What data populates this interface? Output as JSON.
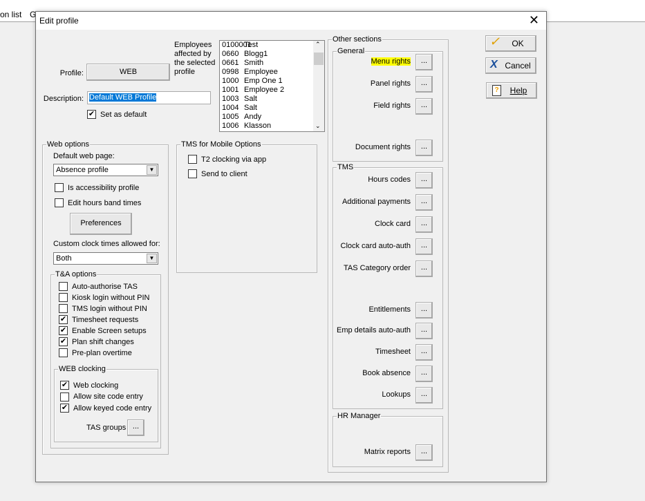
{
  "background": {
    "menu_fragment_1": "on list",
    "menu_fragment_2": "G"
  },
  "dialog": {
    "title": "Edit profile",
    "close_label": "✕"
  },
  "profile": {
    "label": "Profile:",
    "value": "WEB",
    "employees_label": "Employees affected by the selected profile",
    "description_label": "Description:",
    "description_value": "Default WEB Profile",
    "set_default_label": "Set as default",
    "set_default_checked": true
  },
  "employees": [
    [
      "0100001",
      "Test"
    ],
    [
      "0660",
      "Blogg1"
    ],
    [
      "0661",
      "Smith"
    ],
    [
      "0998",
      "Employee"
    ],
    [
      "1000",
      "Emp One 1"
    ],
    [
      "1001",
      "Employee 2"
    ],
    [
      "1003",
      "Salt"
    ],
    [
      "1004",
      "Salt"
    ],
    [
      "1005",
      "Andy"
    ],
    [
      "1006",
      "Klasson"
    ]
  ],
  "web_options": {
    "legend": "Web options",
    "default_page_label": "Default web page:",
    "default_page_value": "Absence profile",
    "accessibility_label": "Is accessibility profile",
    "edit_hours_label": "Edit hours band times",
    "preferences_label": "Preferences",
    "custom_clock_label": "Custom clock times allowed for:",
    "custom_clock_value": "Both"
  },
  "ta_options": {
    "legend": "T&A options",
    "items": [
      {
        "label": "Auto-authorise TAS",
        "checked": false
      },
      {
        "label": "Kiosk login without PIN",
        "checked": false
      },
      {
        "label": "TMS login without PIN",
        "checked": false
      },
      {
        "label": "Timesheet requests",
        "checked": true
      },
      {
        "label": "Enable Screen setups",
        "checked": true
      },
      {
        "label": "Plan shift changes",
        "checked": true
      },
      {
        "label": "Pre-plan overtime",
        "checked": false
      }
    ]
  },
  "web_clocking": {
    "legend": "WEB clocking",
    "items": [
      {
        "label": "Web clocking",
        "checked": true
      },
      {
        "label": "Allow site code entry",
        "checked": false
      },
      {
        "label": "Allow keyed code entry",
        "checked": true
      }
    ],
    "tas_groups_label": "TAS groups"
  },
  "tms_mobile": {
    "legend": "TMS for Mobile Options",
    "items": [
      {
        "label": "T2 clocking via app",
        "checked": false
      },
      {
        "label": "Send to client",
        "checked": false
      }
    ]
  },
  "other_sections": {
    "legend": "Other sections",
    "general_legend": "General",
    "tms_legend": "TMS",
    "hr_legend": "HR Manager",
    "dots": "...",
    "highlight_color": "#ffff00",
    "general": [
      "Menu rights",
      "Panel rights",
      "Field rights",
      "Document rights"
    ],
    "tms": [
      "Hours codes",
      "Additional payments",
      "Clock card",
      "Clock card auto-auth",
      "TAS Category order",
      "Entitlements",
      "Emp details auto-auth",
      "Timesheet",
      "Book absence",
      "Lookups"
    ],
    "hr": [
      "Matrix reports"
    ]
  },
  "actions": {
    "ok": "OK",
    "cancel": "Cancel",
    "help": "Help"
  }
}
